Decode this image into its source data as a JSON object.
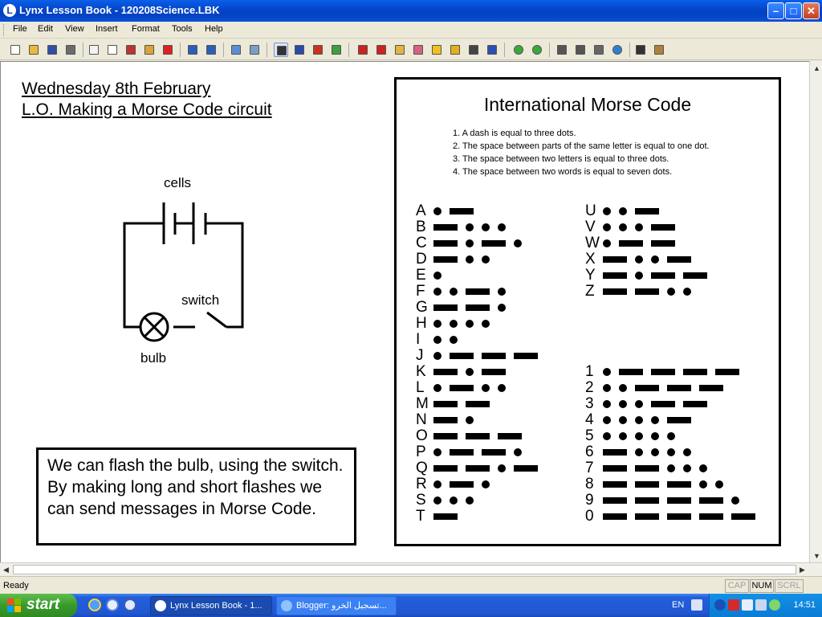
{
  "window": {
    "title": "Lynx Lesson Book - 120208Science.LBK",
    "app_icon": "lynx-icon",
    "controls": [
      "minimize-icon",
      "maximize-icon",
      "close-icon"
    ]
  },
  "menu": [
    "File",
    "Edit",
    "View",
    "Insert",
    "Format",
    "Tools",
    "Help"
  ],
  "toolbar": [
    "new-icon",
    "open-icon",
    "save-icon",
    "print-icon",
    "page-icon",
    "copy-icon",
    "cut-icon",
    "paste-icon",
    "delete-icon",
    "undo-icon",
    "redo-icon",
    "picture-icon",
    "zoom-icon",
    "pointer-icon",
    "text-icon",
    "pen-icon",
    "brush-icon",
    "shape-icon",
    "fill-icon",
    "bucket-icon",
    "eraser-icon",
    "highlighter-icon",
    "marker-icon",
    "crop-icon",
    "lasso-icon",
    "back-icon",
    "forward-icon",
    "speech-icon",
    "keyboard-icon",
    "calculator-icon",
    "globe-icon",
    "move-icon",
    "stamp-icon"
  ],
  "document": {
    "heading_line1": "Wednesday 8th February",
    "heading_line2": "L.O. Making a Morse Code circuit",
    "circuit": {
      "cells_label": "cells",
      "switch_label": "switch",
      "bulb_label": "bulb"
    },
    "note": "We can flash the bulb, using the switch.  By making long and short flashes we can send messages in Morse Code.",
    "morse": {
      "title": "International Morse Code",
      "rules": [
        "1. A dash is equal to three dots.",
        "2. The space between parts of the same letter is equal to one dot.",
        "3. The space between two letters is equal to three dots.",
        "4. The space between two words is equal to seven dots."
      ],
      "left_column": [
        {
          "char": "A",
          "code": ".-"
        },
        {
          "char": "B",
          "code": "-..."
        },
        {
          "char": "C",
          "code": "-.-."
        },
        {
          "char": "D",
          "code": "-.."
        },
        {
          "char": "E",
          "code": "."
        },
        {
          "char": "F",
          "code": "..-."
        },
        {
          "char": "G",
          "code": "--."
        },
        {
          "char": "H",
          "code": "...."
        },
        {
          "char": "I",
          "code": ".."
        },
        {
          "char": "J",
          "code": ".---"
        },
        {
          "char": "K",
          "code": "-.-"
        },
        {
          "char": "L",
          "code": ".-.."
        },
        {
          "char": "M",
          "code": "--"
        },
        {
          "char": "N",
          "code": "-."
        },
        {
          "char": "O",
          "code": "---"
        },
        {
          "char": "P",
          "code": ".--."
        },
        {
          "char": "Q",
          "code": "--.-"
        },
        {
          "char": "R",
          "code": ".-."
        },
        {
          "char": "S",
          "code": "..."
        },
        {
          "char": "T",
          "code": "-"
        }
      ],
      "right_letters": [
        {
          "char": "U",
          "code": "..-"
        },
        {
          "char": "V",
          "code": "...-"
        },
        {
          "char": "W",
          "code": ".--"
        },
        {
          "char": "X",
          "code": "-..-"
        },
        {
          "char": "Y",
          "code": "-.--"
        },
        {
          "char": "Z",
          "code": "--.."
        }
      ],
      "right_digits": [
        {
          "char": "1",
          "code": ".----"
        },
        {
          "char": "2",
          "code": "..---"
        },
        {
          "char": "3",
          "code": "...--"
        },
        {
          "char": "4",
          "code": "....-"
        },
        {
          "char": "5",
          "code": "....."
        },
        {
          "char": "6",
          "code": "-...."
        },
        {
          "char": "7",
          "code": "--..."
        },
        {
          "char": "8",
          "code": "---.."
        },
        {
          "char": "9",
          "code": "----."
        },
        {
          "char": "0",
          "code": "-----"
        }
      ]
    }
  },
  "status": {
    "text": "Ready",
    "indicators": [
      {
        "label": "CAP",
        "active": false
      },
      {
        "label": "NUM",
        "active": true
      },
      {
        "label": "SCRL",
        "active": false
      }
    ]
  },
  "taskbar": {
    "start_label": "start",
    "quick_launch": [
      "ie-icon",
      "media-icon",
      "player-icon"
    ],
    "tasks": [
      {
        "label": "Lynx Lesson Book - 1...",
        "active": true,
        "icon": "lynx-icon"
      },
      {
        "label": "Blogger: تسجيل الخرو...",
        "active": false,
        "icon": "ie-icon"
      }
    ],
    "language": "EN",
    "clock": "14:51"
  },
  "colors": {
    "titlebar": "#0444c9",
    "taskbar": "#245edb",
    "start": "#389a2a",
    "tray": "#0b7bd3"
  }
}
